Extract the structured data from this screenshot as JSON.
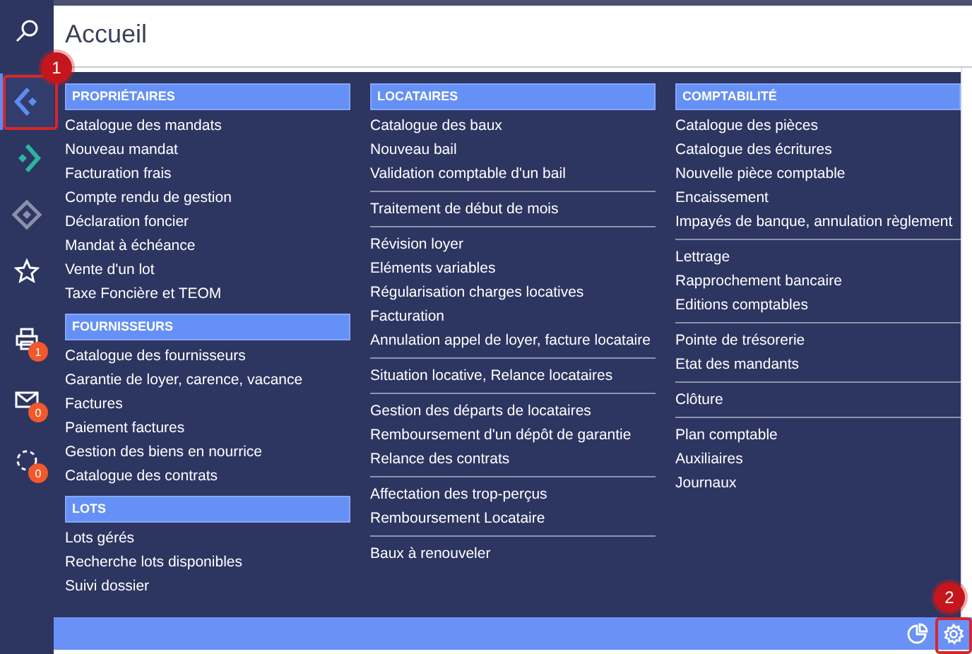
{
  "header": {
    "title": "Accueil"
  },
  "sidebar": {
    "items": [
      {
        "kind": "search",
        "selected": false
      },
      {
        "kind": "chevron-left",
        "selected": true
      },
      {
        "kind": "chevron-right",
        "selected": false
      },
      {
        "kind": "diamond",
        "selected": false
      },
      {
        "kind": "star",
        "selected": false
      },
      {
        "kind": "printer",
        "selected": false,
        "badge": "1"
      },
      {
        "kind": "mail",
        "selected": false,
        "badge": "0"
      },
      {
        "kind": "sync",
        "selected": false,
        "badge": "0"
      }
    ]
  },
  "menu": {
    "columns": [
      {
        "sections": [
          {
            "header": "PROPRIÉTAIRES",
            "groups": [
              [
                "Catalogue des mandats",
                "Nouveau mandat",
                "Facturation frais",
                "Compte rendu de gestion",
                "Déclaration foncier",
                "Mandat à échéance",
                "Vente d'un lot",
                "Taxe Foncière et TEOM"
              ]
            ]
          },
          {
            "header": "FOURNISSEURS",
            "groups": [
              [
                "Catalogue des fournisseurs",
                "Garantie de loyer, carence, vacance",
                "Factures",
                "Paiement factures",
                "Gestion des biens en nourrice",
                "Catalogue des contrats"
              ]
            ]
          },
          {
            "header": "LOTS",
            "groups": [
              [
                "Lots gérés",
                "Recherche lots disponibles",
                "Suivi dossier"
              ]
            ]
          }
        ]
      },
      {
        "sections": [
          {
            "header": "LOCATAIRES",
            "groups": [
              [
                "Catalogue des baux",
                "Nouveau bail",
                "Validation comptable d'un bail"
              ],
              [
                "Traitement de début de mois"
              ],
              [
                "Révision loyer",
                "Eléments variables",
                "Régularisation charges locatives",
                "Facturation",
                "Annulation appel de loyer, facture locataire"
              ],
              [
                "Situation locative, Relance locataires"
              ],
              [
                "Gestion des départs de locataires",
                "Remboursement d'un dépôt de garantie",
                "Relance des contrats"
              ],
              [
                "Affectation des trop-perçus",
                "Remboursement Locataire"
              ],
              [
                "Baux à renouveler"
              ]
            ]
          }
        ]
      },
      {
        "sections": [
          {
            "header": "COMPTABILITÉ",
            "groups": [
              [
                "Catalogue des pièces",
                "Catalogue des écritures",
                "Nouvelle pièce comptable",
                "Encaissement",
                "Impayés de banque, annulation règlement"
              ],
              [
                "Lettrage",
                "Rapprochement bancaire",
                "Editions comptables"
              ],
              [
                "Pointe de trésorerie",
                "Etat des mandants"
              ],
              [
                "Clôture"
              ],
              [
                "Plan comptable",
                "Auxiliaires",
                "Journaux"
              ]
            ]
          }
        ]
      }
    ]
  },
  "footer": {
    "buttons": [
      {
        "kind": "chart"
      },
      {
        "kind": "settings"
      }
    ]
  },
  "annotations": [
    {
      "label": "1",
      "kind": "sidebar"
    },
    {
      "label": "2",
      "kind": "footer"
    }
  ]
}
